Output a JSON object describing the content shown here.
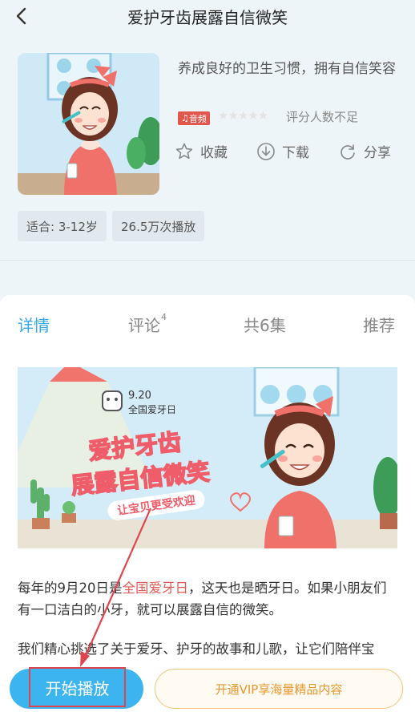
{
  "header": {
    "title": "爱护牙齿展露自信微笑",
    "back_icon": "chevron-left-icon"
  },
  "album": {
    "description": "养成良好的卫生习惯，拥有自信笑容",
    "type_badge": "音频",
    "stars": "★★★★★",
    "stars_filled": 0,
    "rating_text": "评分人数不足",
    "actions": {
      "favorite": "收藏",
      "download": "下载",
      "share": "分享"
    },
    "tags": {
      "age": "适合: 3-12岁",
      "plays": "26.5万次播放"
    }
  },
  "tabs": {
    "detail": "详情",
    "comments": "评论",
    "comments_count": "4",
    "episodes": "共6集",
    "recommend": "推荐"
  },
  "banner": {
    "date": "9.20",
    "event": "全国爱牙日",
    "line1": "爱护牙齿",
    "line2": "展露自信微笑",
    "slogan": "让宝贝更受欢迎"
  },
  "intro": {
    "p1_a": "每年的9月20日是",
    "p1_highlight": "全国爱牙日",
    "p1_b": "，这天也是晒牙日。如果小朋友们有一口洁白的小牙，就可以展露自信的微笑。",
    "p2": "我们精心挑选了关于爱牙、护牙的故事和儿歌，让它们陪伴宝"
  },
  "bottom": {
    "play": "开始播放",
    "vip": "开通VIP享海量精品内容"
  },
  "colors": {
    "accent": "#35a8e8",
    "play_button": "#3cb4f0",
    "highlight": "#e25a55",
    "vip_text": "#e6972d",
    "annotation": "#e0454f"
  }
}
